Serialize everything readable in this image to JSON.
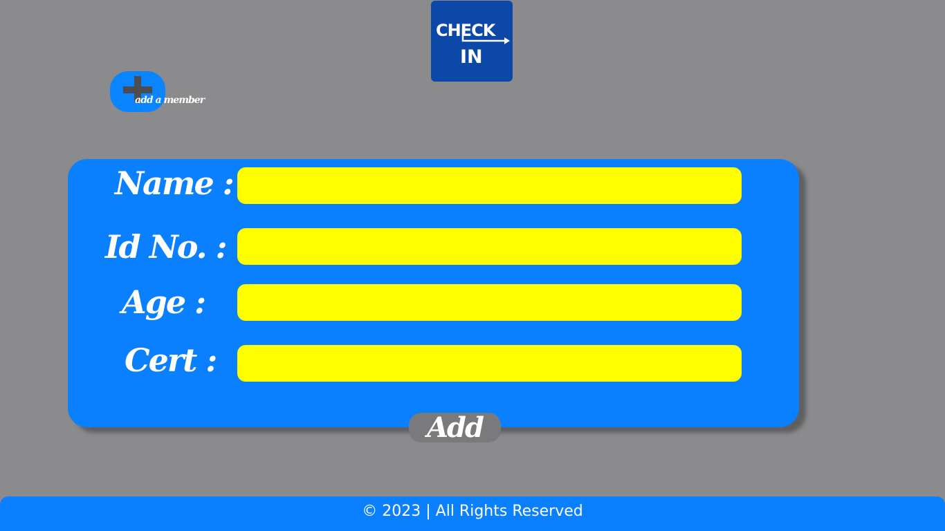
{
  "logo": {
    "line1": "CHECK",
    "line2": "IN",
    "color": "#0b48a8"
  },
  "add_member": {
    "icon": "plus-icon",
    "label": "add a member"
  },
  "form": {
    "fields": [
      {
        "label": "Name :",
        "value": ""
      },
      {
        "label": "Id No. :",
        "value": ""
      },
      {
        "label": "Age :",
        "value": ""
      },
      {
        "label": "Cert :",
        "value": ""
      }
    ],
    "submit_label": "Add"
  },
  "footer": {
    "text": "© 2023 | All Rights Reserved"
  },
  "colors": {
    "background": "#8b8b8e",
    "accent_blue": "#0a80ff",
    "input_yellow": "#ffff00",
    "button_gray": "#7a7a7c"
  }
}
